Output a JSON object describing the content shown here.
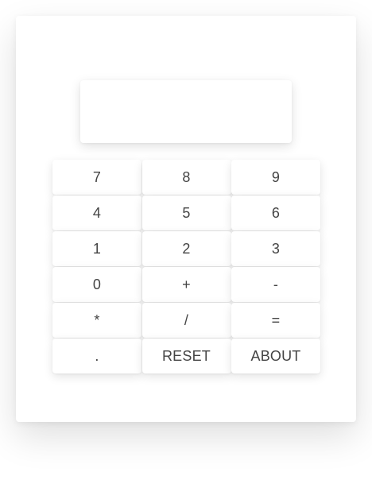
{
  "display": {
    "value": ""
  },
  "keys": {
    "k7": "7",
    "k8": "8",
    "k9": "9",
    "k4": "4",
    "k5": "5",
    "k6": "6",
    "k1": "1",
    "k2": "2",
    "k3": "3",
    "k0": "0",
    "plus": "+",
    "minus": "-",
    "multiply": "*",
    "divide": "/",
    "equals": "=",
    "decimal": ".",
    "reset": "RESET",
    "about": "ABOUT"
  }
}
